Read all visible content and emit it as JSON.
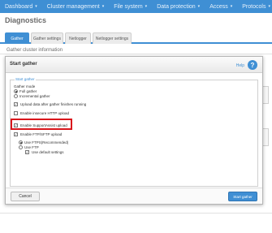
{
  "nav": {
    "items": [
      {
        "label": "Dashboard",
        "has_menu": true
      },
      {
        "label": "Cluster management",
        "has_menu": true
      },
      {
        "label": "File system",
        "has_menu": true
      },
      {
        "label": "Data protection",
        "has_menu": true
      },
      {
        "label": "Access",
        "has_menu": true
      },
      {
        "label": "Protocols",
        "has_menu": true
      }
    ],
    "caret_icon": "▾",
    "color": "#3f8fd4"
  },
  "page": {
    "title": "Diagnostics",
    "section_label": "Gather cluster information"
  },
  "tabs": [
    {
      "label": "Gather",
      "active": true
    },
    {
      "label": "Gather settings",
      "active": false
    },
    {
      "label": "Netlogger",
      "active": false
    },
    {
      "label": "Netlogger settings",
      "active": false
    }
  ],
  "modal": {
    "title": "Start gather",
    "help_label": "Help",
    "help_icon": "?",
    "fieldset_legend": "Start gather",
    "gather_mode_label": "Gather mode",
    "mode_options": [
      {
        "label": "Full gather",
        "checked": true
      },
      {
        "label": "Incremental gather",
        "checked": false
      }
    ],
    "options": [
      {
        "label": "Upload data after gather finishes running",
        "checked": true
      },
      {
        "label": "Enable insecure HTTP upload",
        "checked": false
      },
      {
        "label": "Enable SupportAssist upload",
        "checked": true
      },
      {
        "label": "Enable FTP/SFTP upload",
        "checked": true
      }
    ],
    "ftp_options": [
      {
        "label": "Use FTPS(Recommended)",
        "checked": true
      },
      {
        "label": "Use FTP",
        "checked": false
      }
    ],
    "default_settings": {
      "label": "Use default settings",
      "checked": true
    },
    "cancel_label": "Cancel",
    "start_label": "Start gather",
    "highlight_color": "#d9161c"
  }
}
